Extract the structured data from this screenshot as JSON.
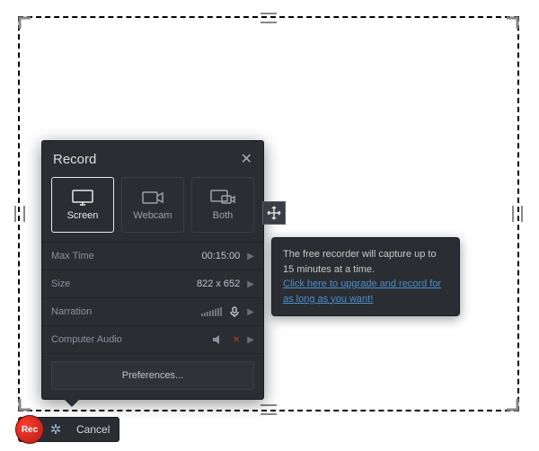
{
  "panel": {
    "title": "Record",
    "modes": {
      "screen": "Screen",
      "webcam": "Webcam",
      "both": "Both"
    },
    "rows": {
      "maxtime": {
        "label": "Max Time",
        "value": "00:15:00"
      },
      "size": {
        "label": "Size",
        "value": "822 x 652"
      },
      "narration": {
        "label": "Narration"
      },
      "compaudio": {
        "label": "Computer Audio"
      }
    },
    "preferences": "Preferences..."
  },
  "tooltip": {
    "line1": "The free recorder will capture up to 15 minutes at a time.",
    "link": "Click here to upgrade and record for as long as you want!"
  },
  "toolbar": {
    "rec": "Rec",
    "cancel": "Cancel"
  }
}
